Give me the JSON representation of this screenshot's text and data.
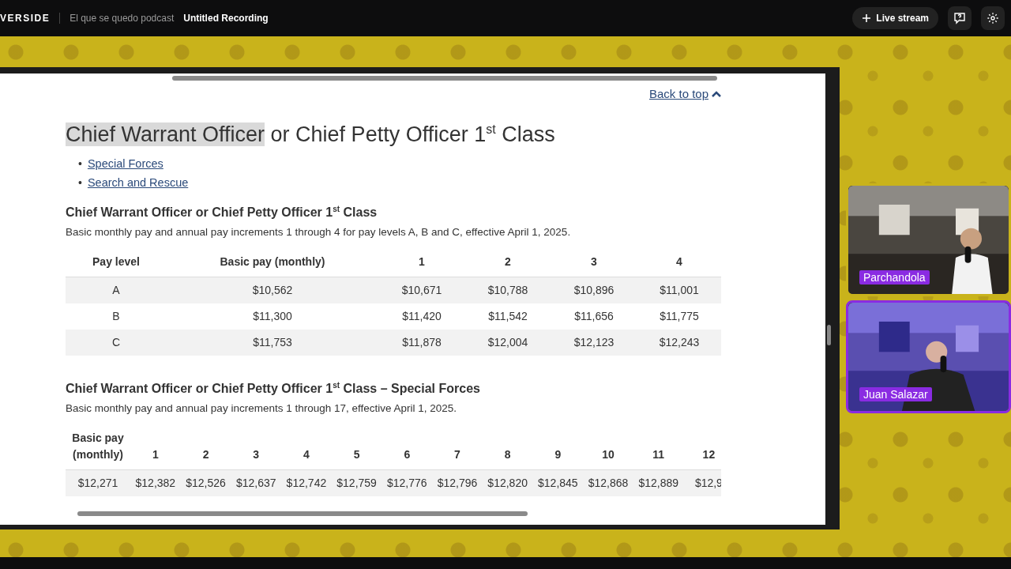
{
  "app_bar": {
    "brand": "VERSIDE",
    "project": "El que se quedo podcast",
    "recording": "Untitled Recording",
    "live_button": "Live stream"
  },
  "document": {
    "back_to_top": "Back to top",
    "title": [
      {
        "text": "Chief Warrant Officer",
        "highlighted": true
      },
      {
        "text": " or Chief Petty Officer 1$^{st}$ Class",
        "highlighted": false
      }
    ],
    "links": [
      {
        "bullet": "•",
        "label": "Special Forces"
      },
      {
        "bullet": "•",
        "label": "Search and Rescue"
      }
    ],
    "sections": [
      {
        "heading": "Chief Warrant Officer or Chief Petty Officer 1$^{st}$ Class",
        "caption": "Basic monthly pay and annual pay increments 1 through 4 for pay levels A, B and C, effective April 1, 2025.",
        "columns": [
          "Pay level",
          "Basic pay (monthly)",
          "1",
          "2",
          "3",
          "4"
        ],
        "rows": [
          [
            "A",
            "$10,562",
            "$10,671",
            "$10,788",
            "$10,896",
            "$11,001"
          ],
          [
            "B",
            "$11,300",
            "$11,420",
            "$11,542",
            "$11,656",
            "$11,775"
          ],
          [
            "C",
            "$11,753",
            "$11,878",
            "$12,004",
            "$12,123",
            "$12,243"
          ]
        ]
      },
      {
        "heading": "Chief Warrant Officer or Chief Petty Officer 1$^{st}$ Class – Special Forces",
        "caption": "Basic monthly pay and annual pay increments 1 through 17, effective April 1, 2025.",
        "columns": [
          "Basic pay (monthly)",
          "1",
          "2",
          "3",
          "4",
          "5",
          "6",
          "7",
          "8",
          "9",
          "10",
          "11",
          "12"
        ],
        "rows": [
          [
            "$12,271",
            "$12,382",
            "$12,526",
            "$12,637",
            "$12,742",
            "$12,759",
            "$12,776",
            "$12,796",
            "$12,820",
            "$12,845",
            "$12,868",
            "$12,889",
            "$12,9"
          ]
        ]
      }
    ]
  },
  "participants": [
    {
      "name": "Parchandola",
      "speaking": false
    },
    {
      "name": "Juan Salazar",
      "speaking": true
    }
  ]
}
